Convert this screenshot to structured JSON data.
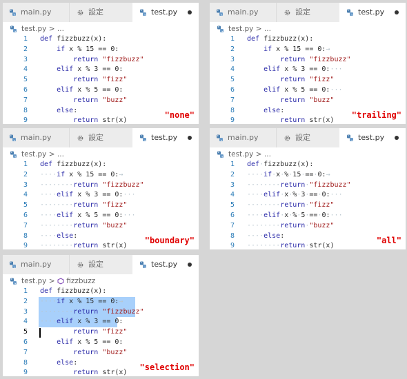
{
  "tabs": [
    "main.py",
    "設定",
    "test.py"
  ],
  "breadcrumb": {
    "file": "test.py",
    "sep": ">",
    "tail": "...",
    "symbol": "fizzbuzz"
  },
  "code_lines": [
    {
      "n": "1",
      "text": "def fizzbuzz(x):"
    },
    {
      "n": "2",
      "text": "    if x % 15 == 0:"
    },
    {
      "n": "3",
      "text": "        return \"fizzbuzz\""
    },
    {
      "n": "4",
      "text": "    elif x % 3 == 0:"
    },
    {
      "n": "5",
      "text": "        return \"fizz\""
    },
    {
      "n": "6",
      "text": "    elif x % 5 == 0:"
    },
    {
      "n": "7",
      "text": "        return \"buzz\""
    },
    {
      "n": "8",
      "text": "    else:"
    },
    {
      "n": "9",
      "text": "        return str(x)"
    }
  ],
  "panels": [
    {
      "mode": "none",
      "label": "\"none\""
    },
    {
      "mode": "trailing",
      "label": "\"trailing\""
    },
    {
      "mode": "boundary",
      "label": "\"boundary\""
    },
    {
      "mode": "all",
      "label": "\"all\""
    },
    {
      "mode": "selection",
      "label": "\"selection\""
    }
  ],
  "colors": {
    "keyword": "#2a2aa8",
    "string": "#a11d1d",
    "line_number": "#2b7cb8",
    "label": "#e00000",
    "selection": "#a8d0fb"
  }
}
